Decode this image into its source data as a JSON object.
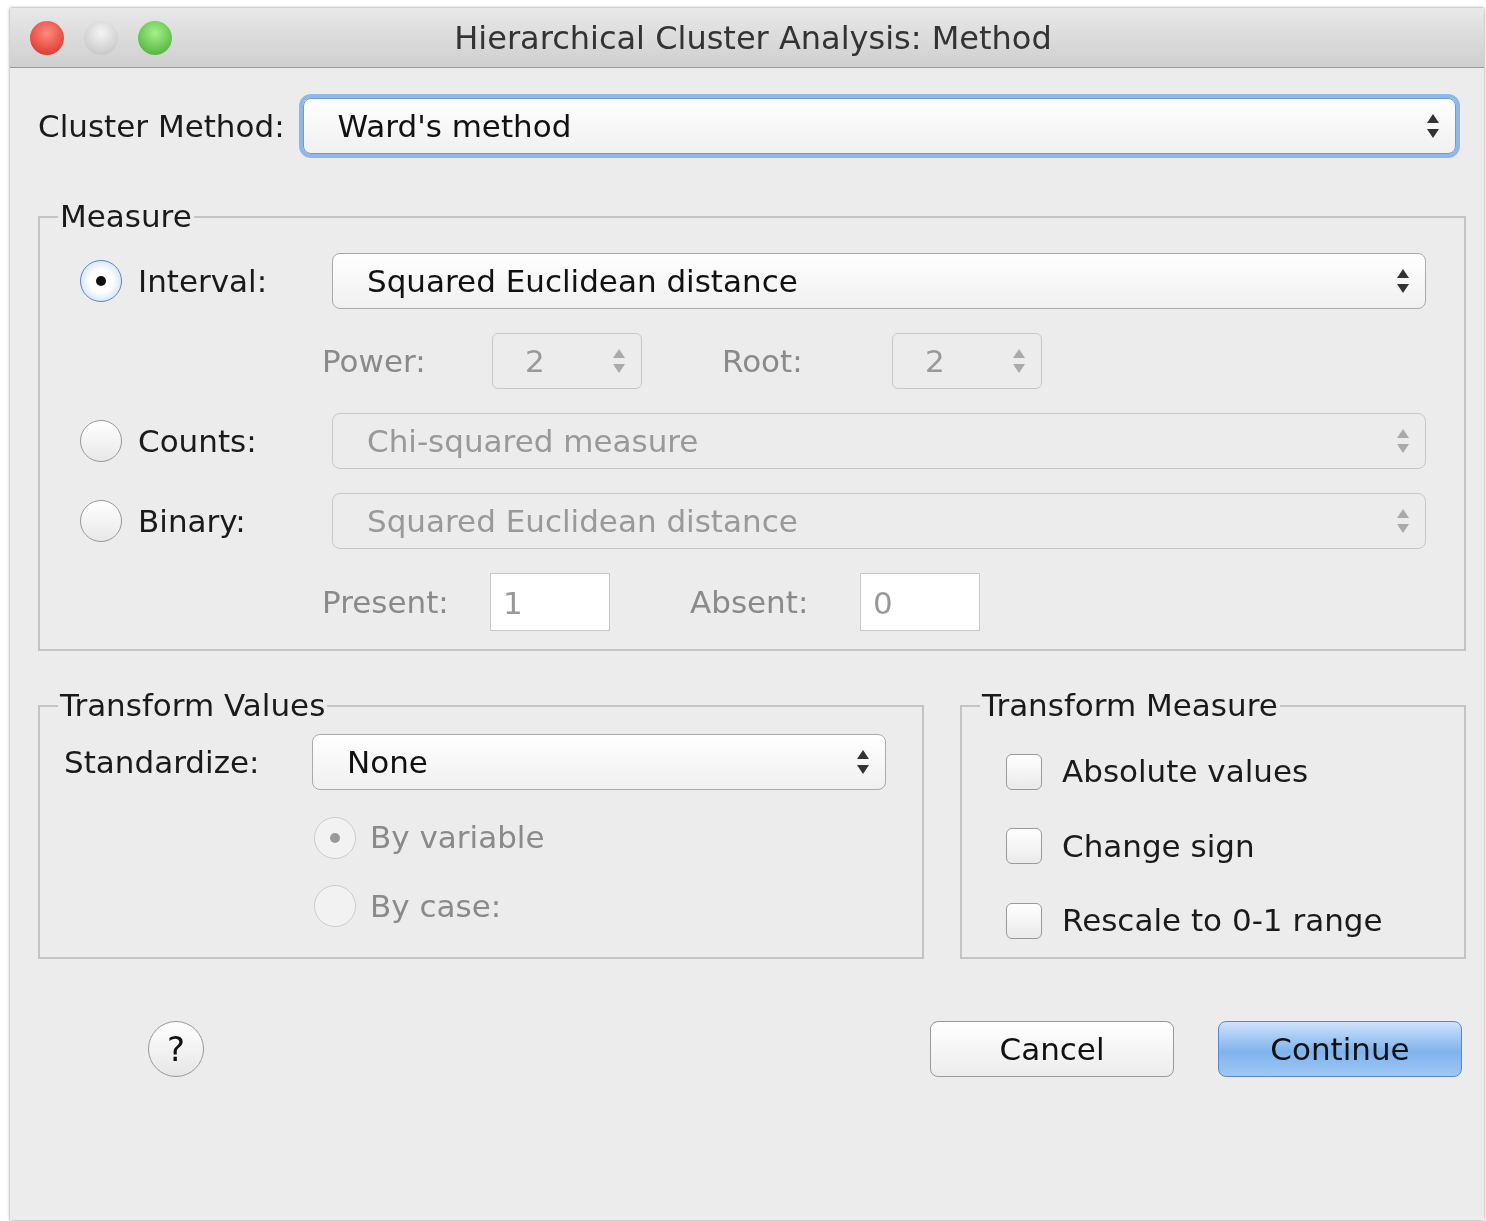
{
  "window": {
    "title": "Hierarchical Cluster Analysis: Method"
  },
  "cluster_method": {
    "label": "Cluster Method:",
    "value": "Ward's method",
    "focused": true
  },
  "measure": {
    "title": "Measure",
    "options": [
      {
        "label": "Interval:",
        "selected": true,
        "value": "Squared Euclidean distance",
        "disabled": false
      },
      {
        "label": "Counts:",
        "selected": false,
        "value": "Chi-squared measure",
        "disabled": true
      },
      {
        "label": "Binary:",
        "selected": false,
        "value": "Squared Euclidean distance",
        "disabled": true
      }
    ],
    "power": {
      "label": "Power:",
      "value": "2",
      "disabled": true
    },
    "root": {
      "label": "Root:",
      "value": "2",
      "disabled": true
    },
    "present": {
      "label": "Present:",
      "value": "1",
      "disabled": true
    },
    "absent": {
      "label": "Absent:",
      "value": "0",
      "disabled": true
    }
  },
  "transform_values": {
    "title": "Transform Values",
    "standardize": {
      "label": "Standardize:",
      "value": "None"
    },
    "options": [
      {
        "label": "By variable",
        "selected": true,
        "disabled": true
      },
      {
        "label": "By case:",
        "selected": false,
        "disabled": true
      }
    ]
  },
  "transform_measure": {
    "title": "Transform Measure",
    "options": [
      {
        "label": "Absolute values",
        "checked": false
      },
      {
        "label": "Change sign",
        "checked": false
      },
      {
        "label": "Rescale to 0-1 range",
        "checked": false
      }
    ]
  },
  "help": {
    "label": "?"
  },
  "buttons": [
    {
      "label": "Cancel",
      "default": false
    },
    {
      "label": "Continue",
      "default": true
    }
  ]
}
